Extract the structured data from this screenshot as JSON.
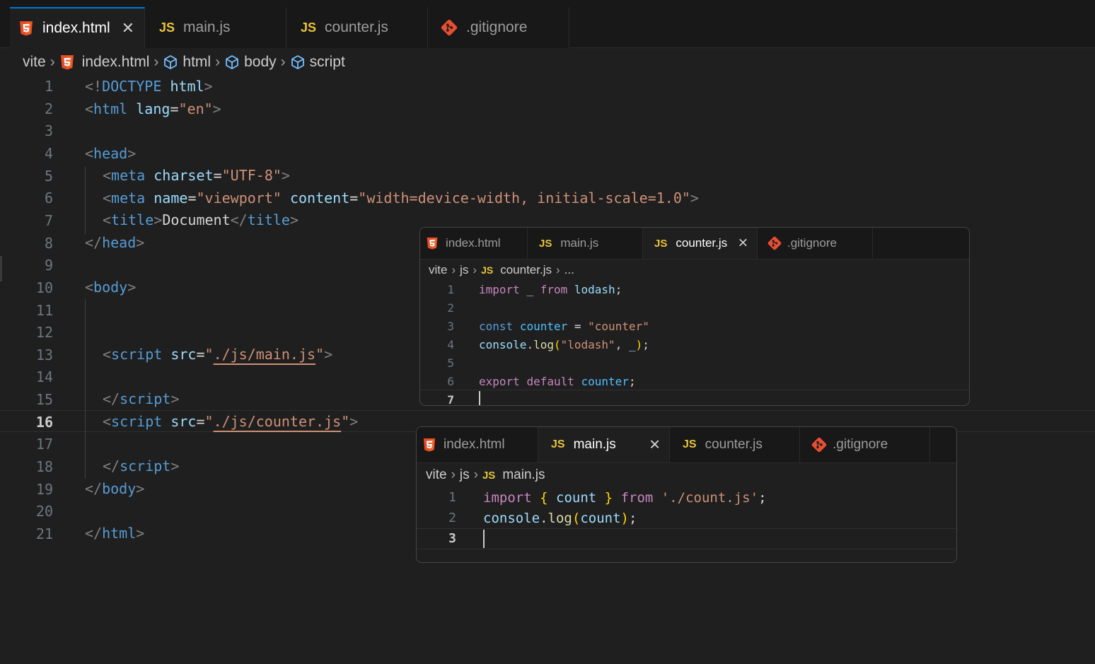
{
  "editor": {
    "tabs": [
      {
        "label": "index.html",
        "icon": "html5-icon"
      },
      {
        "label": "main.js",
        "icon": "js-icon"
      },
      {
        "label": "counter.js",
        "icon": "js-icon"
      },
      {
        "label": ".gitignore",
        "icon": "git-icon"
      }
    ],
    "close_glyph": "✕",
    "js_badge": "JS",
    "breadcrumb": {
      "root": "vite",
      "file": "index.html",
      "s1": "html",
      "s2": "body",
      "s3": "script"
    },
    "line_numbers": [
      "1",
      "2",
      "3",
      "4",
      "5",
      "6",
      "7",
      "8",
      "9",
      "10",
      "11",
      "12",
      "13",
      "14",
      "15",
      "16",
      "17",
      "18",
      "19",
      "20",
      "21"
    ],
    "current_line": "16",
    "code": {
      "l1_open": "<!",
      "l1_doctype": "DOCTYPE",
      "l1_html": "html",
      "l1_close": ">",
      "lt": "<",
      "gt": ">",
      "lts": "</",
      "eq": "=",
      "l2_tag": "html",
      "l2_attr": "lang",
      "l2_val": "\"en\"",
      "l4_tag": "head",
      "meta": "meta",
      "l5_attr": "charset",
      "l5_val": "\"UTF-8\"",
      "l6_attr1": "name",
      "l6_val1": "\"viewport\"",
      "l6_attr2": "content",
      "l6_val2": "\"width=device-width, initial-scale=1.0\"",
      "title": "title",
      "l7_text": "Document",
      "body": "body",
      "script": "script",
      "src": "src",
      "quote": "\"",
      "l13_path": "./js/main.js",
      "l16_path": "./js/counter.js"
    }
  },
  "counter_popup": {
    "tabs": [
      {
        "label": "index.html"
      },
      {
        "label": "main.js"
      },
      {
        "label": "counter.js"
      },
      {
        "label": ".gitignore"
      }
    ],
    "breadcrumb": {
      "root": "vite",
      "folder": "js",
      "file": "counter.js",
      "more": "..."
    },
    "line_numbers": [
      "1",
      "2",
      "3",
      "4",
      "5",
      "6",
      "7"
    ],
    "code": {
      "import": "import",
      "underscore": "_",
      "from": "from",
      "lodash": "lodash",
      "semi": ";",
      "const": "const",
      "counter": "counter",
      "eq": " = ",
      "counter_str": "\"counter\"",
      "console": "console",
      "dot": ".",
      "log": "log",
      "paren_open": "(",
      "lodash_str": "\"lodash\"",
      "comma": ", ",
      "paren_close": ")",
      "export": "export",
      "default": "default"
    }
  },
  "main_popup": {
    "tabs": [
      {
        "label": "index.html"
      },
      {
        "label": "main.js"
      },
      {
        "label": "counter.js"
      },
      {
        "label": ".gitignore"
      }
    ],
    "breadcrumb": {
      "root": "vite",
      "folder": "js",
      "file": "main.js"
    },
    "line_numbers": [
      "1",
      "2",
      "3"
    ],
    "code": {
      "import": "import",
      "brace_open": "{",
      "count": "count",
      "brace_close": "}",
      "from": "from",
      "path": "'./count.js'",
      "semi": ";",
      "console": "console",
      "dot": ".",
      "log": "log",
      "paren_open": "(",
      "paren_close": ")"
    }
  },
  "colors": {
    "html5": "#e44d26",
    "js": "#e8c53a",
    "git": "#e84e31",
    "accent": "#0078d4"
  }
}
